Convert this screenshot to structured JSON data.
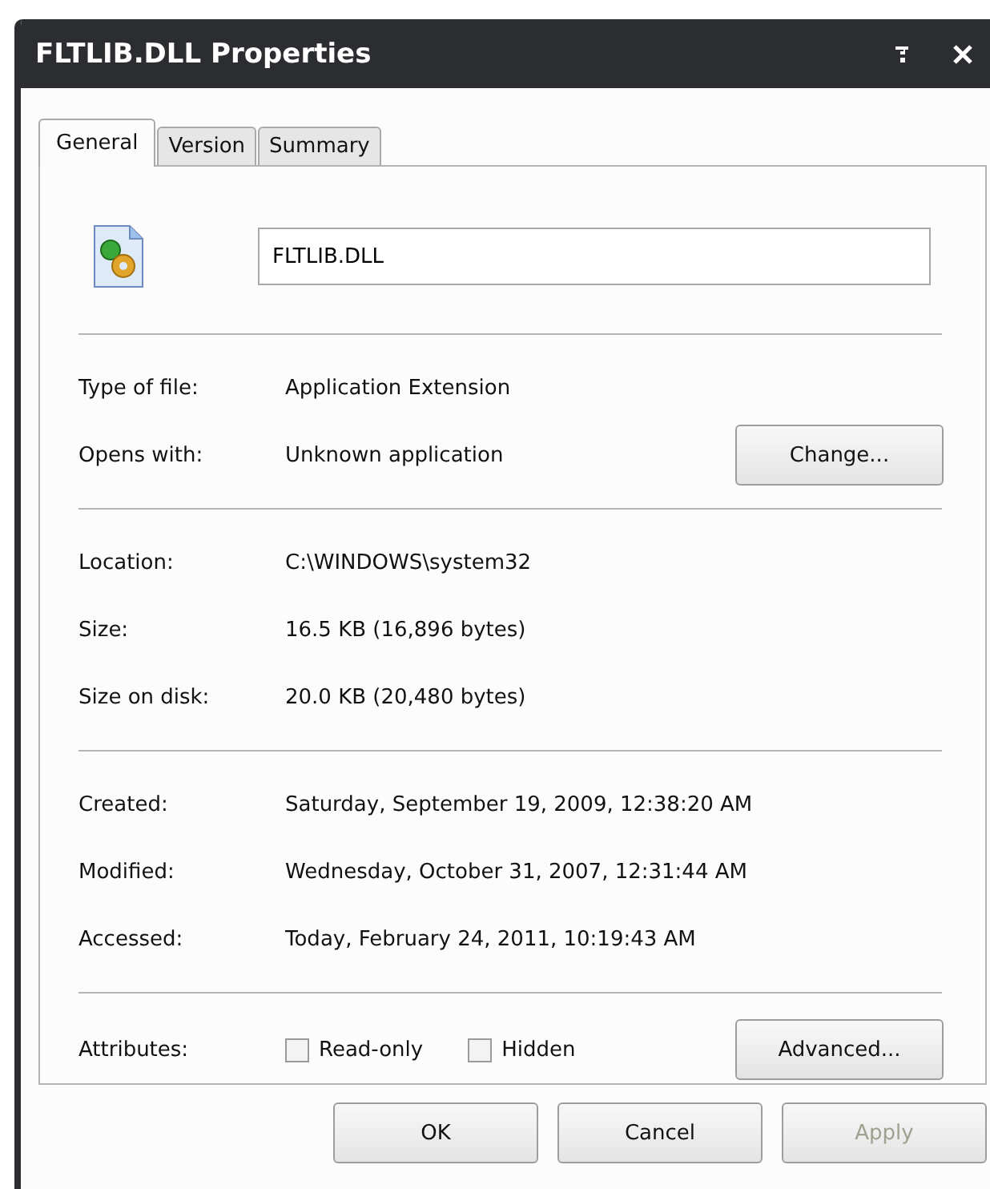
{
  "window": {
    "title": "FLTLIB.DLL Properties"
  },
  "tabs": [
    {
      "label": "General",
      "selected": true
    },
    {
      "label": "Version",
      "selected": false
    },
    {
      "label": "Summary",
      "selected": false
    }
  ],
  "file_name": {
    "value": "FLTLIB.DLL"
  },
  "sections": [
    {
      "rows": [
        {
          "label": "Type of file:",
          "value": "Application Extension"
        },
        {
          "label": "Opens with:",
          "value": "Unknown application",
          "button": "Change..."
        }
      ]
    },
    {
      "rows": [
        {
          "label": "Location:",
          "value": "C:\\WINDOWS\\system32"
        },
        {
          "label": "Size:",
          "value": "16.5 KB (16,896 bytes)"
        },
        {
          "label": "Size on disk:",
          "value": "20.0 KB (20,480 bytes)"
        }
      ]
    },
    {
      "rows": [
        {
          "label": "Created:",
          "value": "Saturday, September 19, 2009, 12:38:20 AM"
        },
        {
          "label": "Modified:",
          "value": "Wednesday, October 31, 2007, 12:31:44 AM"
        },
        {
          "label": "Accessed:",
          "value": "Today, February 24, 2011, 10:19:43 AM"
        }
      ]
    }
  ],
  "attributes": {
    "label": "Attributes:",
    "options": [
      {
        "label": "Read-only",
        "checked": false
      },
      {
        "label": "Hidden",
        "checked": false
      }
    ],
    "button": "Advanced..."
  },
  "buttons": [
    {
      "label": "OK",
      "disabled": false
    },
    {
      "label": "Cancel",
      "disabled": false
    },
    {
      "label": "Apply",
      "disabled": true
    }
  ]
}
